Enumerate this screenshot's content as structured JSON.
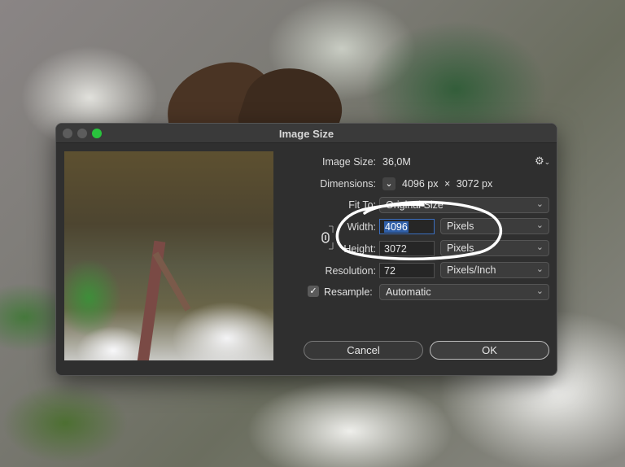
{
  "dialog": {
    "title": "Image Size",
    "image_size": {
      "label": "Image Size:",
      "value": "36,0M"
    },
    "dimensions": {
      "label": "Dimensions:",
      "width": "4096 px",
      "separator": "×",
      "height": "3072 px"
    },
    "fit_to": {
      "label": "Fit To:",
      "value": "Original Size"
    },
    "width": {
      "label": "Width:",
      "value": "4096",
      "unit": "Pixels"
    },
    "height": {
      "label": "Height:",
      "value": "3072",
      "unit": "Pixels"
    },
    "resolution": {
      "label": "Resolution:",
      "value": "72",
      "unit": "Pixels/Inch"
    },
    "resample": {
      "label": "Resample:",
      "value": "Automatic",
      "checked": true
    },
    "buttons": {
      "cancel": "Cancel",
      "ok": "OK"
    }
  },
  "icons": {
    "settings": "gear-icon",
    "dimensions_toggle": "chevron-down-icon",
    "constrain": "link-icon",
    "dropdown": "chevron-down-icon",
    "checkmark": "checkmark-icon"
  },
  "colors": {
    "dialog_bg": "#2f2f2f",
    "selection": "#2f5fa8",
    "annotation": "#ffffff",
    "close_light": "#29c33d"
  }
}
